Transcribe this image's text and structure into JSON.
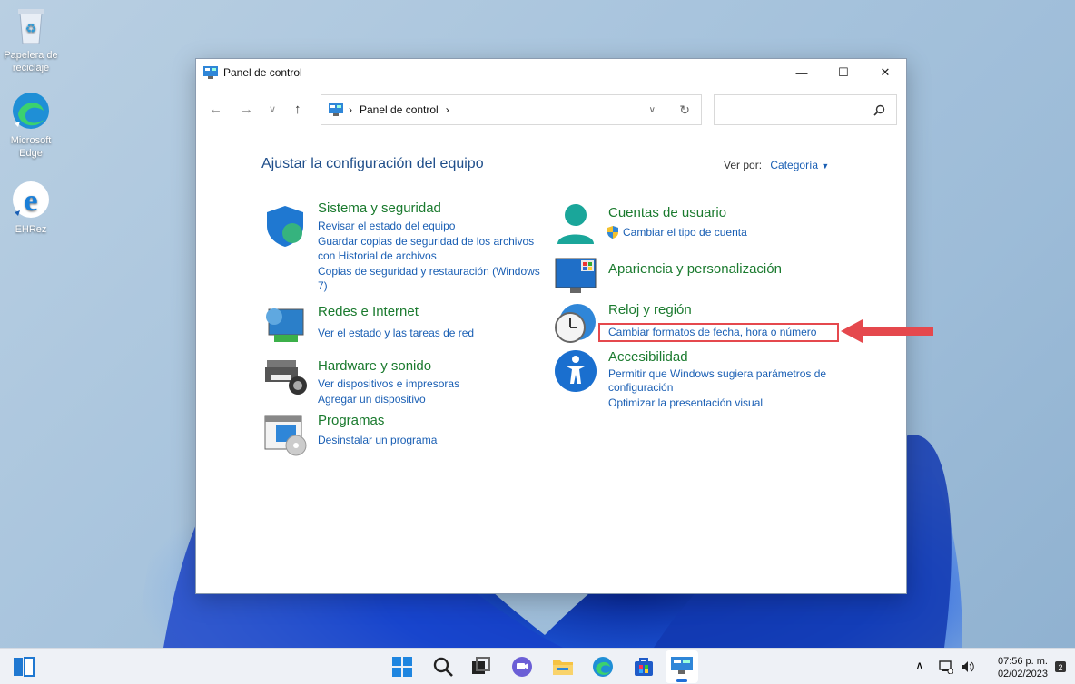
{
  "desktop": {
    "icons": [
      {
        "label": "Papelera de reciclaje"
      },
      {
        "label": "Microsoft Edge"
      },
      {
        "label": "EHRez"
      }
    ]
  },
  "window": {
    "title": "Panel de control",
    "address": {
      "crumb": "Panel de control"
    },
    "heading": "Ajustar la configuración del equipo",
    "view_by_label": "Ver por:",
    "view_by_value": "Categoría",
    "categories": [
      {
        "title": "Sistema y seguridad",
        "links": [
          "Revisar el estado del equipo",
          "Guardar copias de seguridad de los archivos",
          "con Historial de archivos",
          "Copias de seguridad y restauración (Windows",
          "7)"
        ]
      },
      {
        "title": "Redes e Internet",
        "links": [
          "Ver el estado y las tareas de red"
        ]
      },
      {
        "title": "Hardware y sonido",
        "links": [
          "Ver dispositivos e impresoras",
          "Agregar un dispositivo"
        ]
      },
      {
        "title": "Programas",
        "links": [
          "Desinstalar un programa"
        ]
      },
      {
        "title": "Cuentas de usuario",
        "links": [
          "Cambiar el tipo de cuenta"
        ]
      },
      {
        "title": "Apariencia y personalización",
        "links": []
      },
      {
        "title": "Reloj y región",
        "links": [
          "Cambiar formatos de fecha, hora o número"
        ]
      },
      {
        "title": "Accesibilidad",
        "links": [
          "Permitir que Windows sugiera parámetros de",
          "configuración",
          "Optimizar la presentación visual"
        ]
      }
    ]
  },
  "taskbar": {
    "time": "07:56 p. m.",
    "date": "02/02/2023"
  },
  "colors": {
    "accent": "#1a5fb4",
    "category_title": "#1a7a2e",
    "highlight": "#e5484d"
  }
}
